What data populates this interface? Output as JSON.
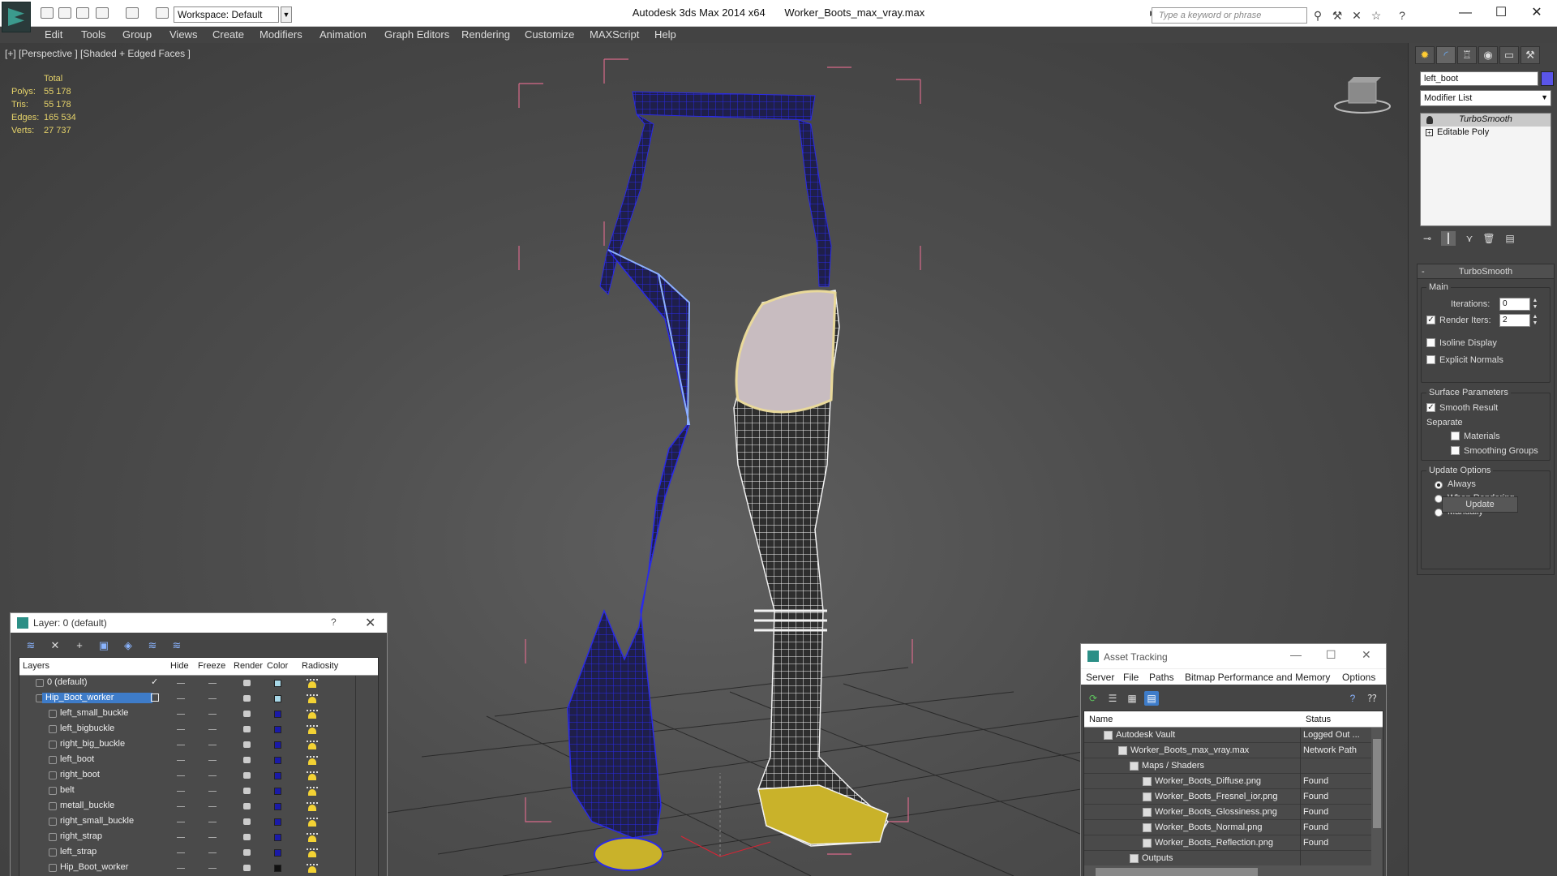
{
  "titlebar": {
    "workspace": "Workspace: Default",
    "app_name": "Autodesk 3ds Max  2014 x64",
    "file_name": "Worker_Boots_max_vray.max",
    "search_placeholder": "Type a keyword or phrase"
  },
  "menubar": [
    "Edit",
    "Tools",
    "Group",
    "Views",
    "Create",
    "Modifiers",
    "Animation",
    "Graph Editors",
    "Rendering",
    "Customize",
    "MAXScript",
    "Help"
  ],
  "viewport": {
    "label": "[+] [Perspective ] [Shaded + Edged Faces ]",
    "stats": {
      "total_label": "Total",
      "rows": [
        {
          "key": "Polys:",
          "value": "55 178"
        },
        {
          "key": "Tris:",
          "value": "55 178"
        },
        {
          "key": "Edges:",
          "value": "165 534"
        },
        {
          "key": "Verts:",
          "value": "27 737"
        }
      ]
    },
    "colors": {
      "selected_wire": "#1e1ee0",
      "unselected_wire": "#ffffff",
      "sole": "#d9c43a",
      "bbox": "#d86a8a"
    }
  },
  "command_panel": {
    "object_name": "left_boot",
    "object_color": "#5a55e8",
    "modifier_list": "Modifier List",
    "stack": [
      {
        "label": "TurboSmooth"
      },
      {
        "label": "Editable Poly"
      }
    ],
    "rollout": {
      "title": "TurboSmooth",
      "main_group": "Main",
      "iterations_label": "Iterations:",
      "iterations_value": "0",
      "render_iters_label": "Render Iters:",
      "render_iters_value": "2",
      "isoline_label": "Isoline Display",
      "explicit_normals_label": "Explicit Normals",
      "surface_group": "Surface Parameters",
      "smooth_result_label": "Smooth Result",
      "separate_label": "Separate",
      "materials_label": "Materials",
      "smoothing_groups_label": "Smoothing Groups",
      "update_group": "Update Options",
      "always_label": "Always",
      "when_rendering_label": "When Rendering",
      "manually_label": "Manually",
      "update_button": "Update"
    }
  },
  "layer_window": {
    "title": "Layer: 0 (default)",
    "help": "?",
    "columns": {
      "layers": "Layers",
      "hide": "Hide",
      "freeze": "Freeze",
      "render": "Render",
      "color": "Color",
      "radiosity": "Radiosity"
    },
    "rows": [
      {
        "name": "0 (default)",
        "color": "#a8d8e8"
      },
      {
        "name": "Hip_Boot_worker",
        "color": "#a8d8e8"
      },
      {
        "name": "left_small_buckle",
        "color": "#1a1aa8"
      },
      {
        "name": "left_bigbuckle",
        "color": "#1a1aa8"
      },
      {
        "name": "right_big_buckle",
        "color": "#1a1aa8"
      },
      {
        "name": "left_boot",
        "color": "#1a1aa8"
      },
      {
        "name": "right_boot",
        "color": "#1a1aa8"
      },
      {
        "name": "belt",
        "color": "#1a1aa8"
      },
      {
        "name": "metall_buckle",
        "color": "#1a1aa8"
      },
      {
        "name": "right_small_buckle",
        "color": "#1a1aa8"
      },
      {
        "name": "right_strap",
        "color": "#1a1aa8"
      },
      {
        "name": "left_strap",
        "color": "#1a1aa8"
      },
      {
        "name": "Hip_Boot_worker",
        "color": "#111111"
      }
    ]
  },
  "asset_window": {
    "title": "Asset Tracking",
    "menu": [
      "Server",
      "File",
      "Paths",
      "Bitmap Performance and Memory",
      "Options"
    ],
    "columns": {
      "name": "Name",
      "status": "Status"
    },
    "rows": [
      {
        "name": "Autodesk Vault",
        "status": "Logged Out ..."
      },
      {
        "name": "Worker_Boots_max_vray.max",
        "status": "Network Path"
      },
      {
        "name": "Maps / Shaders",
        "status": ""
      },
      {
        "name": "Worker_Boots_Diffuse.png",
        "status": "Found"
      },
      {
        "name": "Worker_Boots_Fresnel_ior.png",
        "status": "Found"
      },
      {
        "name": "Worker_Boots_Glossiness.png",
        "status": "Found"
      },
      {
        "name": "Worker_Boots_Normal.png",
        "status": "Found"
      },
      {
        "name": "Worker_Boots_Reflection.png",
        "status": "Found"
      },
      {
        "name": "Outputs",
        "status": ""
      }
    ]
  }
}
